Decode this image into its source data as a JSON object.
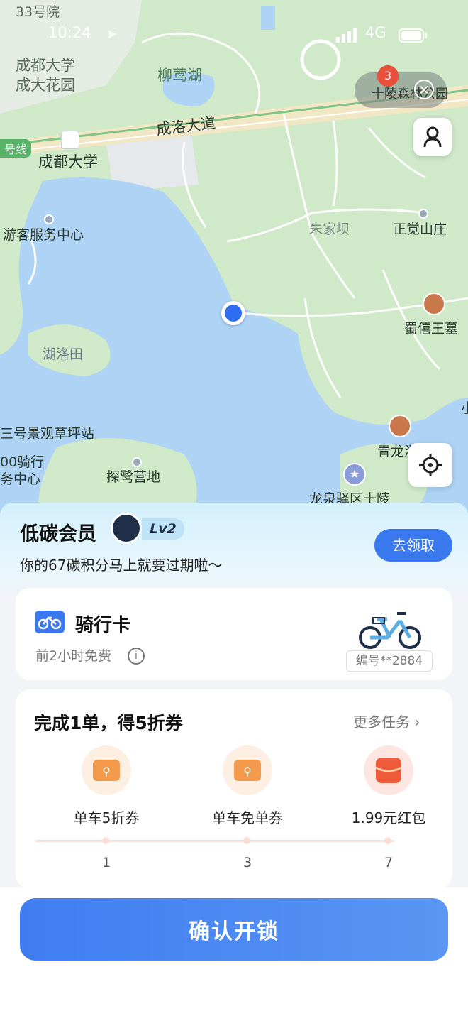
{
  "status_bar": {
    "time": "10:24",
    "network": "4G"
  },
  "map": {
    "labels": {
      "l33": "33号院",
      "chengdu_univ_garden_1": "成都大学",
      "chengdu_univ_garden_2": "成大花园",
      "liuying_lake": "柳莺湖",
      "chengluo_road": "成洛大道",
      "line_tag": "号线",
      "chengdu_univ": "成都大学",
      "visitor_center": "游客服务中心",
      "zhujiaba": "朱家坝",
      "zhengjue_mountain": "正觉山庄",
      "shuxi_tomb": "蜀僖王墓",
      "huluotian": "湖洛田",
      "scenic_station": "三号景观草坪站",
      "riding_center_1": "00骑行",
      "riding_center_2": "务中心",
      "tanlu_camp": "探鹭营地",
      "qinglong": "青龙湖",
      "longquan": "龙泉驿区十陵",
      "shiling_park": "十陵森林公园",
      "right_edge": "小"
    },
    "badge_count": "3"
  },
  "banner": {
    "title": "低碳会员",
    "level": "Lv2",
    "subtitle": "你的67碳积分马上就要过期啦～",
    "claim_label": "去领取"
  },
  "ride_card": {
    "title": "骑行卡",
    "desc": "前2小时免费",
    "bike_id": "编号**2884"
  },
  "task_card": {
    "title": "完成1单，得5折券",
    "more_label": "更多任务",
    "rewards": [
      {
        "name": "单车5折券",
        "step": "1"
      },
      {
        "name": "单车免单券",
        "step": "3"
      },
      {
        "name": "1.99元红包",
        "step": "7"
      }
    ]
  },
  "unlock_label": "确认开锁",
  "colors": {
    "accent": "#3f7df2",
    "map_green": "#cfe9c9",
    "map_water": "#aed3f5"
  }
}
